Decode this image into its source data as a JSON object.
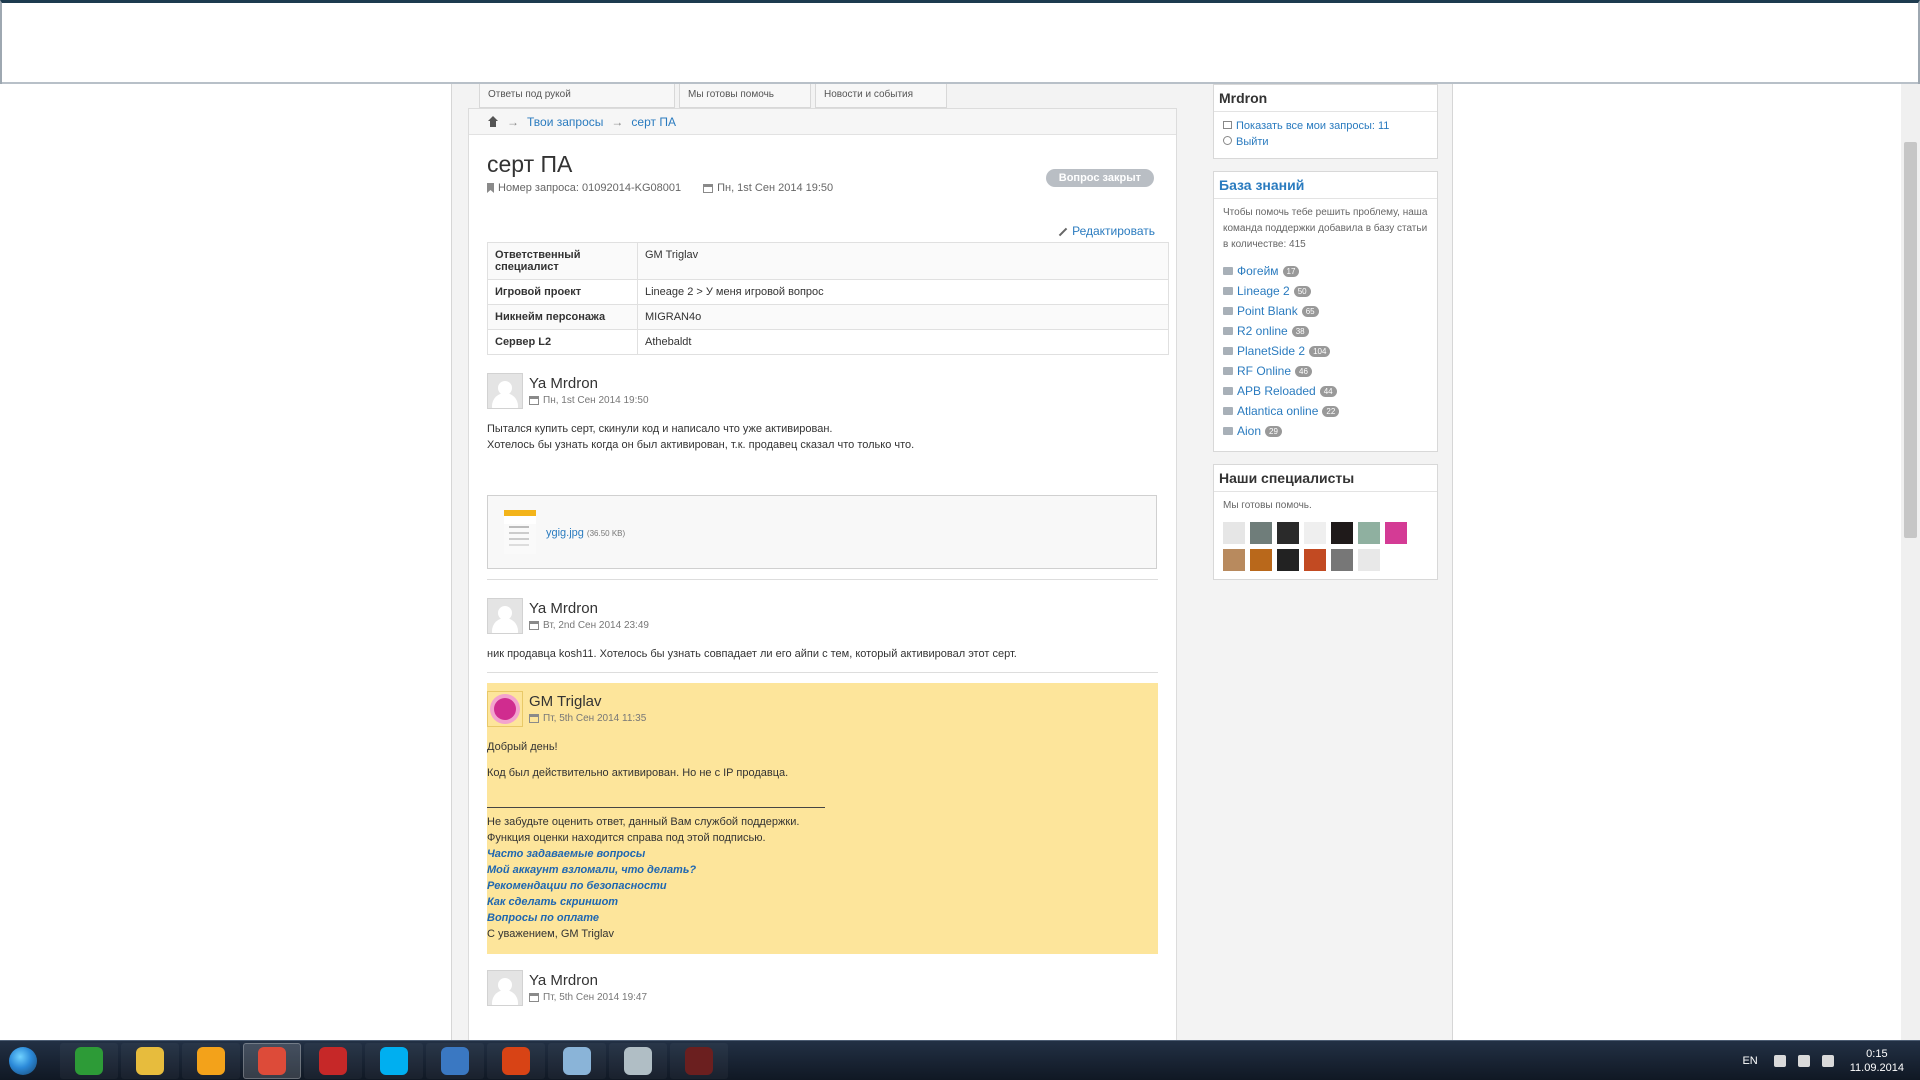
{
  "tabs": [
    {
      "title": "",
      "subtitle": "Ответы под рукой"
    },
    {
      "title": "",
      "subtitle": "Мы готовы помочь"
    },
    {
      "title": "",
      "subtitle": "Новости и события"
    }
  ],
  "breadcrumb": {
    "home_icon": "home-icon",
    "sep": "→",
    "items": [
      "Твои запросы",
      "серт ПА"
    ]
  },
  "ticket": {
    "title": "серт ПА",
    "request_number": "Номер запроса: 01092014-KG08001",
    "created": "Пн, 1st Сен 2014 19:50",
    "status": "Вопрос закрыт",
    "edit_label": "Редактировать",
    "properties": [
      {
        "key": "Ответственный специалист",
        "value": "GM Triglav"
      },
      {
        "key": "Игровой проект",
        "value": "Lineage 2 > У меня игровой вопрос"
      },
      {
        "key": "Никнейм персонажа",
        "value": "MIGRAN4o"
      },
      {
        "key": "Сервер L2",
        "value": "Athebaldt"
      }
    ]
  },
  "posts": [
    {
      "author": "Ya Mrdron",
      "date": "Пн, 1st Сен 2014 19:50",
      "line1": "Пытался купить серт, скинули код и написало что уже активирован.",
      "line2": "Хотелось бы узнать когда он был активирован, т.к. продавец сказал что только что.",
      "attachment": {
        "name": "ygig.jpg",
        "size": "(36.50 KB)"
      }
    },
    {
      "author": "Ya Mrdron",
      "date": "Вт, 2nd Сен 2014 23:49",
      "line1": "ник продавца kosh11. Хотелось бы узнать совпадает ли его айпи с тем, который активировал этот серт."
    },
    {
      "author": "GM Triglav",
      "date": "Пт, 5th Сен 2014 11:35",
      "greeting": "Добрый день!",
      "answer": "Код был действительно активирован. Но не с IP продавца.",
      "sig_line1": "Не забудьте оценить ответ, данный Вам службой поддержки.",
      "sig_line2": "Функция оценки находится справа под этой подписью.",
      "links": [
        "Часто задаваемые вопросы",
        "Мой аккаунт взломали, что делать?",
        "Рекомендации по безопасности",
        "Как сделать скриншот",
        "Вопросы по оплате"
      ],
      "closing": "С уважением, GM Triglav"
    },
    {
      "author": "Ya Mrdron",
      "date": "Пт, 5th Сен 2014 19:47"
    }
  ],
  "sidebar": {
    "user": {
      "name": "Mrdron",
      "show_all": "Показать все мои запросы: 11",
      "logout": "Выйти"
    },
    "kb": {
      "title": "База знаний",
      "desc": "Чтобы помочь тебе решить проблему, наша команда поддержки добавила в базу статьи в количестве: 415",
      "items": [
        {
          "name": "Фогейм",
          "count": "17"
        },
        {
          "name": "Lineage 2",
          "count": "50"
        },
        {
          "name": "Point Blank",
          "count": "65"
        },
        {
          "name": "R2 online",
          "count": "38"
        },
        {
          "name": "PlanetSide 2",
          "count": "104"
        },
        {
          "name": "RF Online",
          "count": "46"
        },
        {
          "name": "APB Reloaded",
          "count": "44"
        },
        {
          "name": "Atlantica online",
          "count": "22"
        },
        {
          "name": "Aion",
          "count": "29"
        }
      ]
    },
    "specialists": {
      "title": "Наши специалисты",
      "desc": "Мы готовы помочь.",
      "avatar_colors": [
        "#e6e6e6",
        "#6f7d7a",
        "#2a2a2a",
        "#efefef",
        "#1f1a1a",
        "#8fb0a0",
        "#d43b95",
        "#b88a5e",
        "#b9681b",
        "#222222",
        "#c24a22",
        "#777777",
        "#e8e8e8"
      ]
    }
  },
  "taskbar": {
    "apps": [
      {
        "name": "utorrent-icon",
        "color": "#2d9b37"
      },
      {
        "name": "explorer-icon",
        "color": "#e7bc3d"
      },
      {
        "name": "aimp-icon",
        "color": "#f3a21a"
      },
      {
        "name": "chrome-icon",
        "color": "#dd4b39"
      },
      {
        "name": "aida64-icon",
        "color": "#c62828"
      },
      {
        "name": "skype-icon",
        "color": "#00aff0"
      },
      {
        "name": "tool-icon",
        "color": "#3a78c2"
      },
      {
        "name": "ccleaner-icon",
        "color": "#d84315"
      },
      {
        "name": "book-icon",
        "color": "#8ab4d8"
      },
      {
        "name": "game-launcher-icon",
        "color": "#b0bec5"
      },
      {
        "name": "lineage-icon",
        "color": "#6b1f1f"
      }
    ],
    "lang": "EN",
    "time": "0:15",
    "date": "11.09.2014"
  }
}
